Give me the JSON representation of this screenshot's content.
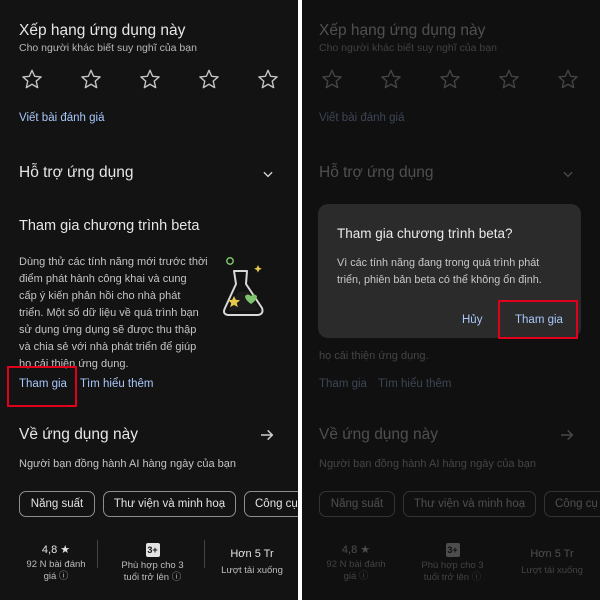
{
  "rate": {
    "title": "Xếp hạng ứng dụng này",
    "subtitle": "Cho người khác biết suy nghĩ của bạn",
    "write_review": "Viết bài đánh giá"
  },
  "support": {
    "title": "Hỗ trợ ứng dụng"
  },
  "beta": {
    "title": "Tham gia chương trình beta",
    "lines": [
      "Dùng thử các tính năng mới trước thời",
      "điểm phát hành công khai và cung",
      "cấp ý kiến phản hồi cho nhà phát",
      "triển. Một số dữ liệu về quá trình bạn",
      "sử dụng ứng dụng sẽ được thu thập",
      "và chia sẻ với nhà phát triển để giúp",
      "họ cải thiện ứng dụng."
    ],
    "join": "Tham gia",
    "learn_more": "Tìm hiểu thêm"
  },
  "about": {
    "title": "Về ứng dụng này",
    "description": "Người bạn đồng hành AI hàng ngày của bạn",
    "chips": [
      "Năng suất",
      "Thư viện và minh hoạ",
      "Công cụ"
    ]
  },
  "stats": {
    "rating": "4,8 ★",
    "rating_label": [
      "92 N bài đánh",
      "giá ⓘ"
    ],
    "age_badge": "3+",
    "age_label": [
      "Phù hợp cho 3",
      "tuổi trở lên ⓘ"
    ],
    "downloads": "Hơn 5 Tr",
    "downloads_label": "Lượt tải xuống"
  },
  "dialog": {
    "title": "Tham gia chương trình beta?",
    "body_lines": [
      "Vì các tính năng đang trong quá trình phát",
      "triển, phiên bản beta có thể không ổn định."
    ],
    "cancel": "Hủy",
    "confirm": "Tham gia"
  },
  "colors": {
    "background": "#131313",
    "link": "#a8c7fa",
    "highlight": "#e0001b",
    "dialog": "#2b2b2b"
  }
}
